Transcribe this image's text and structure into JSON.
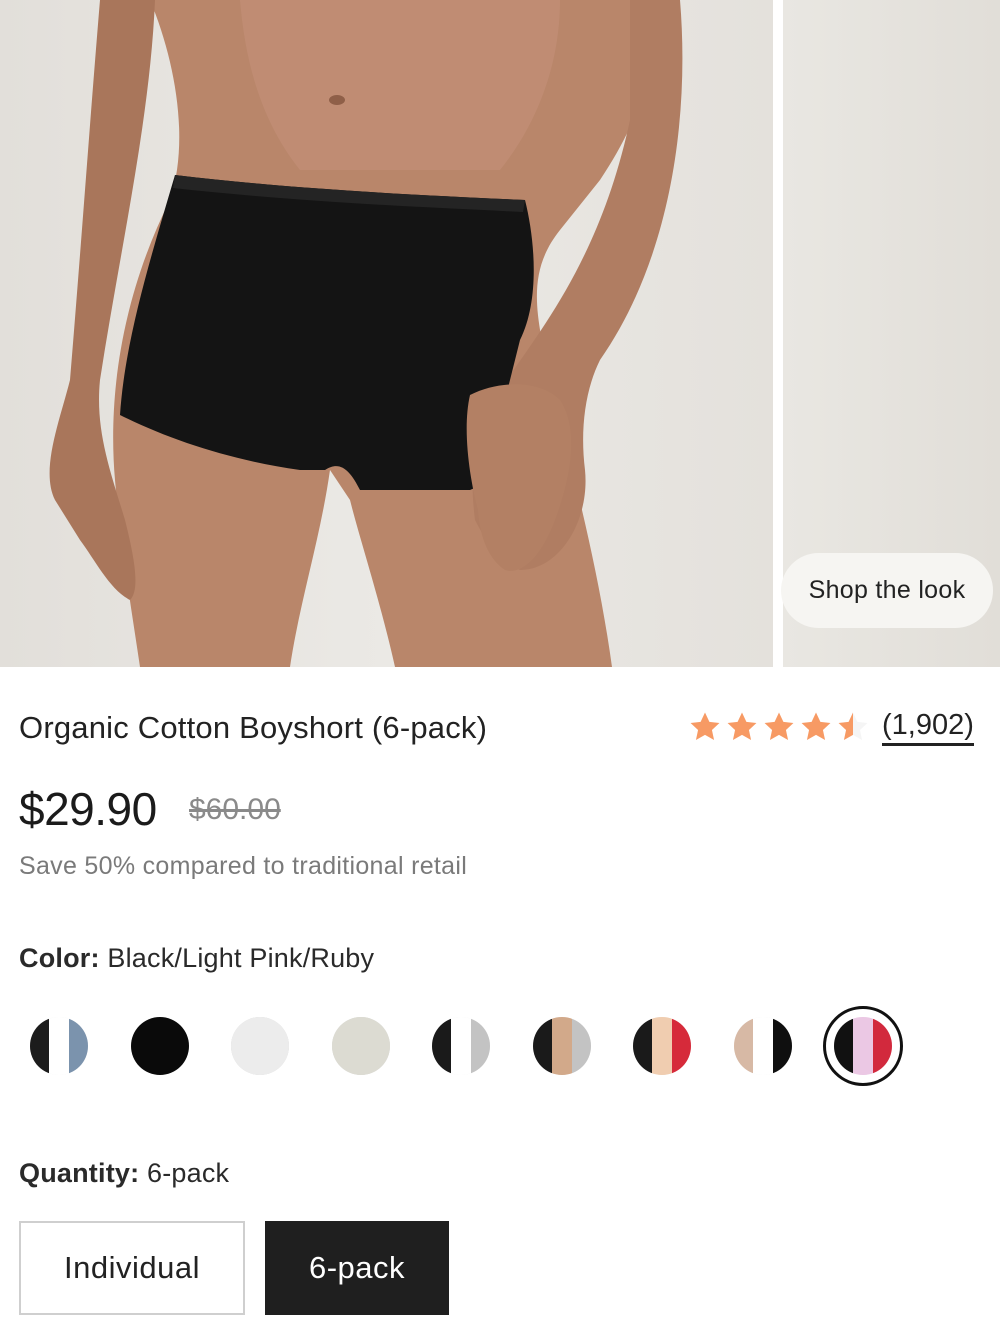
{
  "gallery": {
    "images": [
      {
        "alt": "Model wearing black boyshort"
      },
      {
        "alt": "Second product image"
      }
    ],
    "shop_look_label": "Shop the look"
  },
  "product": {
    "title": "Organic Cotton Boyshort (6-pack)",
    "rating": 4.5,
    "rating_max": 5,
    "review_count": "(1,902)",
    "star_color": "#f79a64",
    "price": "$29.90",
    "original_price": "$60.00",
    "save_note": "Save 50% compared to traditional retail"
  },
  "color": {
    "label": "Color:",
    "selected": "Black/Light Pink/Ruby",
    "swatches": [
      {
        "name": "black-blue",
        "stripes": [
          "#1c1c1c",
          "#ffffff",
          "#7b93ad"
        ]
      },
      {
        "name": "black",
        "stripes": [
          "#0a0a0a"
        ]
      },
      {
        "name": "white",
        "stripes": [
          "#ececec"
        ]
      },
      {
        "name": "bone",
        "stripes": [
          "#dcdbd2"
        ]
      },
      {
        "name": "black-white-grey",
        "stripes": [
          "#1a1a1a",
          "#ffffff",
          "#c3c3c3"
        ]
      },
      {
        "name": "black-tan-grey",
        "stripes": [
          "#1a1a1a",
          "#d2a98a",
          "#c3c3c3"
        ]
      },
      {
        "name": "black-tan-red",
        "stripes": [
          "#1a1a1a",
          "#f0cdb0",
          "#d62a3a"
        ]
      },
      {
        "name": "tan-white-black",
        "stripes": [
          "#d7b9a5",
          "#ffffff",
          "#0f0f0f"
        ]
      },
      {
        "name": "black-pink-ruby",
        "stripes": [
          "#111111",
          "#ebc8e4",
          "#d2293d"
        ],
        "selected": true
      }
    ]
  },
  "quantity": {
    "label": "Quantity:",
    "selected": "6-pack",
    "options": [
      "Individual",
      "6-pack"
    ]
  }
}
